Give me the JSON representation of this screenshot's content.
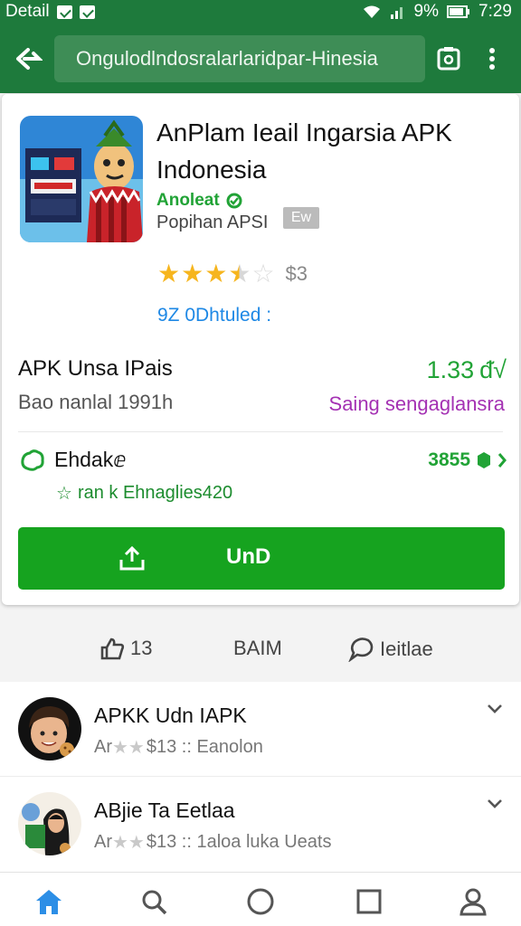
{
  "status_bar": {
    "left_text": "Detail",
    "percent": "9%",
    "time": "7:29"
  },
  "app_bar": {
    "url": "Ongulodlndosralarlaridpar-Hinesia"
  },
  "app": {
    "title": "AnPlam Ieail Ingarsia APK Indonesia",
    "developer": "Anoleat",
    "category": "Popihan APSI",
    "badge": "Ew",
    "rating_stars": 3.5,
    "rating_count": "$3",
    "downloads": "9Z 0Dhtuled :"
  },
  "info": {
    "size_label": "APK Unsa IPais",
    "size_value": "1.33",
    "size_unit": "ᵭ√",
    "date_label": "Bao nanlal 1991h",
    "date_value": "Saing sengaglansra",
    "family_label": "Ehdakⅇ",
    "family_sub": "ran k Ehnaglies420",
    "family_value": "3855"
  },
  "install_button": {
    "label": "UnD"
  },
  "actions": {
    "share_count": "13",
    "middle_label": "BAIM",
    "comment_label": "Ieitlae"
  },
  "related": [
    {
      "name": "APKK Udn IAPK",
      "meta_prefix": "Ar",
      "meta_rest": "$13 :: Eanolon"
    },
    {
      "name": "ABjie Ta Eetlaa",
      "meta_prefix": "Ar",
      "meta_rest": "$13 :: 1aloa luka Ueats"
    }
  ],
  "colors": {
    "brand_green": "#1e7a3c",
    "accent_green": "#21a336",
    "button_green": "#16a31f",
    "link_blue": "#1e88e5",
    "purple": "#a431b3",
    "star_gold": "#f6b51e"
  },
  "icons": {
    "back": "back-arrow-icon",
    "camera": "camera-icon",
    "menu": "overflow-menu-icon",
    "install": "download-icon",
    "home": "home-icon",
    "search": "search-icon",
    "circle": "circle-icon",
    "square": "square-icon",
    "profile": "profile-icon"
  }
}
